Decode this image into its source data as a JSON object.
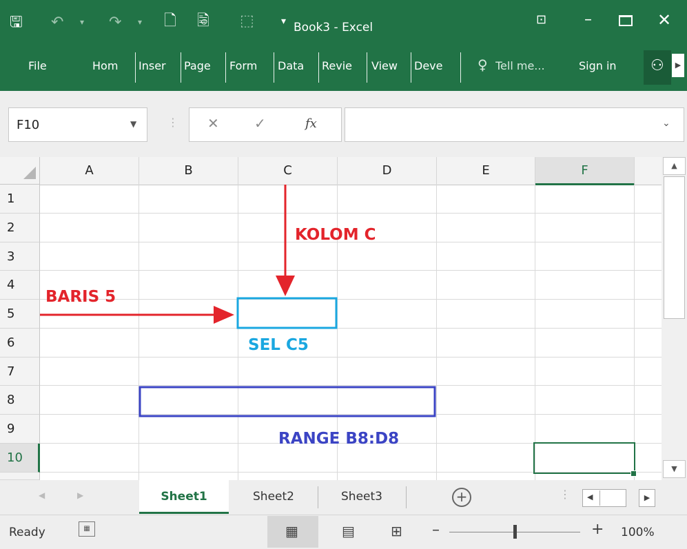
{
  "window": {
    "title": "Book3 - Excel"
  },
  "quick_access": {
    "save_icon": "save-icon",
    "undo_icon": "undo-icon",
    "redo_icon": "redo-icon",
    "new_icon": "new-document-icon",
    "preview_icon": "print-preview-icon",
    "customize_icon": "customize-qat-icon"
  },
  "ribbon": {
    "tabs": [
      "File",
      "Hom",
      "Inser",
      "Page",
      "Form",
      "Data",
      "Revie",
      "View",
      "Deve"
    ],
    "tell_me": "Tell me...",
    "sign_in": "Sign in"
  },
  "formula_bar": {
    "name_box": "F10",
    "fx_label": "fx",
    "formula_value": ""
  },
  "grid": {
    "columns": [
      "A",
      "B",
      "C",
      "D",
      "E",
      "F"
    ],
    "rows": [
      "1",
      "2",
      "3",
      "4",
      "5",
      "6",
      "7",
      "8",
      "9",
      "10"
    ],
    "active_cell": "F10"
  },
  "annotations": {
    "kolom": "KOLOM C",
    "baris": "BARIS 5",
    "sel": "SEL C5",
    "range": "RANGE B8:D8"
  },
  "sheets": [
    "Sheet1",
    "Sheet2",
    "Sheet3"
  ],
  "active_sheet": "Sheet1",
  "status": {
    "ready": "Ready",
    "zoom": "100%"
  },
  "colors": {
    "excel_green": "#217346",
    "annotation_red": "#e3242b",
    "annotation_cyan": "#1aa7e0",
    "annotation_blue": "#3b44c4"
  }
}
